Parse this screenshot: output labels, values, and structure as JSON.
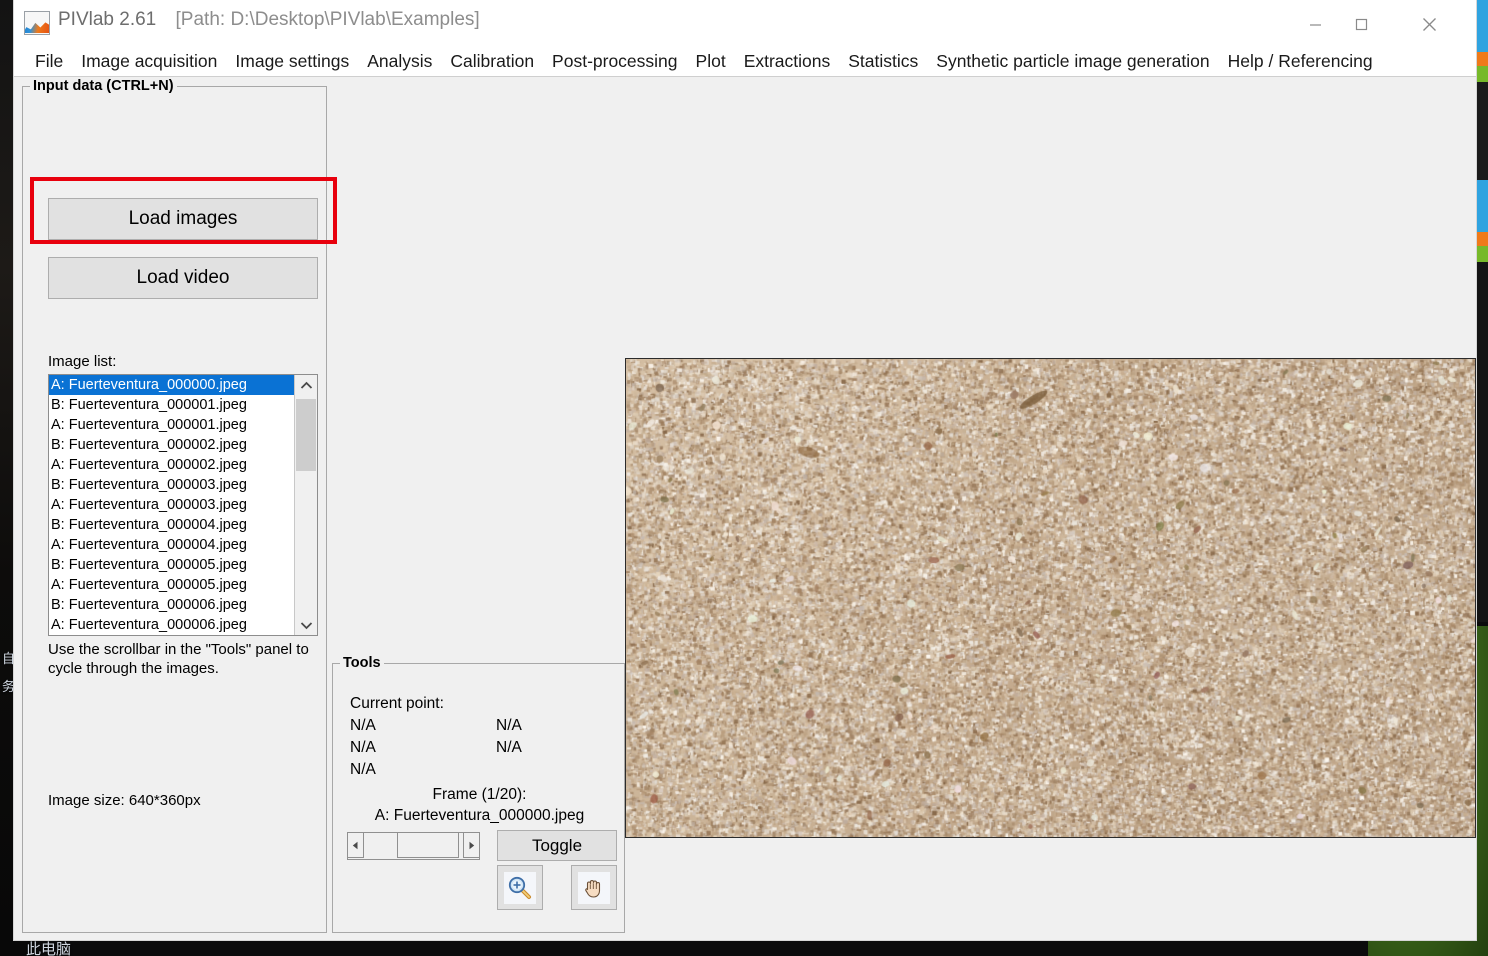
{
  "window": {
    "title_app": "PIVlab 2.61",
    "title_path": "[Path: D:\\Desktop\\PIVlab\\Examples]",
    "icon_name": "pivlab-app-icon",
    "minimize_label": "Minimize",
    "maximize_label": "Maximize",
    "close_label": "Close"
  },
  "menubar": {
    "items": [
      {
        "label": "File"
      },
      {
        "label": "Image acquisition"
      },
      {
        "label": "Image settings"
      },
      {
        "label": "Analysis"
      },
      {
        "label": "Calibration"
      },
      {
        "label": "Post-processing"
      },
      {
        "label": "Plot"
      },
      {
        "label": "Extractions"
      },
      {
        "label": "Statistics"
      },
      {
        "label": "Synthetic particle image generation"
      },
      {
        "label": "Help / Referencing"
      }
    ]
  },
  "input_panel": {
    "title": "Input data (CTRL+N)",
    "load_images_label": "Load images",
    "load_video_label": "Load video",
    "image_list_label": "Image list:",
    "hint": "Use the scrollbar in the \"Tools\" panel to cycle through the images.",
    "image_size_label": "Image size: 640*360px",
    "highlight_color": "#e8000d",
    "selection_color": "#0a72d4",
    "selected_index": 0,
    "image_list": [
      "A: Fuerteventura_000000.jpeg",
      "B: Fuerteventura_000001.jpeg",
      "A: Fuerteventura_000001.jpeg",
      "B: Fuerteventura_000002.jpeg",
      "A: Fuerteventura_000002.jpeg",
      "B: Fuerteventura_000003.jpeg",
      "A: Fuerteventura_000003.jpeg",
      "B: Fuerteventura_000004.jpeg",
      "A: Fuerteventura_000004.jpeg",
      "B: Fuerteventura_000005.jpeg",
      "A: Fuerteventura_000005.jpeg",
      "B: Fuerteventura_000006.jpeg",
      "A: Fuerteventura_000006.jpeg"
    ]
  },
  "tools_panel": {
    "title": "Tools",
    "current_point_label": "Current point:",
    "values": {
      "v1": "N/A",
      "v2": "N/A",
      "v3": "N/A",
      "v4": "N/A",
      "v5": "N/A"
    },
    "frame_label": "Frame (1/20):",
    "frame_file": "A: Fuerteventura_000000.jpeg",
    "toggle_label": "Toggle",
    "scrollbar_left": "◀",
    "scrollbar_right": "▶",
    "zoom_icon_name": "zoom-in-magnifier-icon",
    "pan_icon_name": "pan-hand-icon"
  },
  "image_display": {
    "alt": "Fuerteventura sand particle image",
    "base_color": "#c6ab8c"
  },
  "desktop": {
    "cjk_left_1": "自",
    "cjk_left_2": "务",
    "cjk_bottom": "此电脑"
  }
}
